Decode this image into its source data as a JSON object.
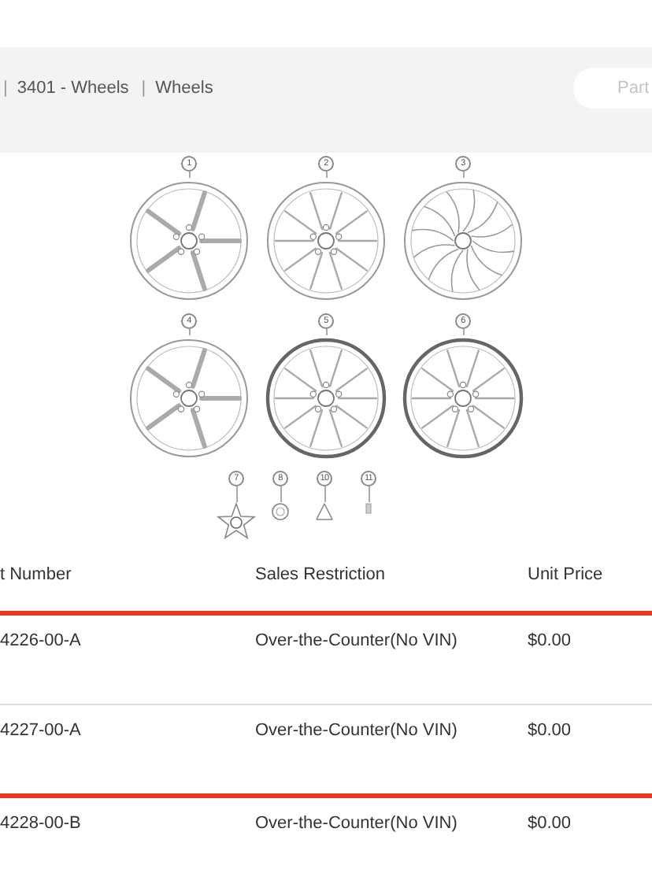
{
  "header": {
    "breadcrumb": [
      {
        "separator": "|",
        "label": "3401 - Wheels"
      },
      {
        "separator": "|",
        "label": "Wheels"
      }
    ],
    "search": {
      "placeholder": "Part"
    }
  },
  "diagram": {
    "rows": [
      {
        "callouts": [
          {
            "label": "1",
            "kind": "wheel-split"
          },
          {
            "label": "2",
            "kind": "wheel-multi"
          },
          {
            "label": "3",
            "kind": "wheel-aero"
          }
        ]
      },
      {
        "callouts": [
          {
            "label": "4",
            "kind": "wheel-split"
          },
          {
            "label": "5",
            "kind": "wheel-dark"
          },
          {
            "label": "6",
            "kind": "wheel-dark"
          }
        ]
      },
      {
        "callouts": [
          {
            "label": "7",
            "kind": "star-cap"
          },
          {
            "label": "8",
            "kind": "cap"
          },
          {
            "label": "10",
            "kind": "valve"
          },
          {
            "label": "11",
            "kind": "pin"
          }
        ]
      }
    ]
  },
  "table": {
    "columns": [
      "t Number",
      "Sales Restriction",
      "Unit Price"
    ],
    "rows": [
      {
        "highlighted": true,
        "cells": [
          "4226-00-A",
          "Over-the-Counter(No VIN)",
          "$0.00"
        ]
      },
      {
        "highlighted": false,
        "cells": [
          "4227-00-A",
          "Over-the-Counter(No VIN)",
          "$0.00"
        ]
      },
      {
        "highlighted": true,
        "cells": [
          "4228-00-B",
          "Over-the-Counter(No VIN)",
          "$0.00"
        ]
      }
    ]
  }
}
